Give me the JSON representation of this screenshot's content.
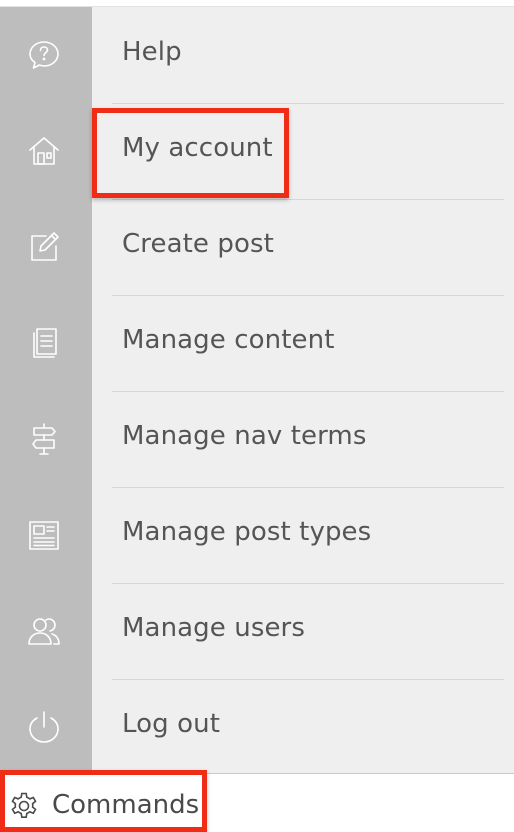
{
  "menu": {
    "items": [
      {
        "label": "Help",
        "icon": "help-bubble-icon"
      },
      {
        "label": "My account",
        "icon": "home-icon"
      },
      {
        "label": "Create post",
        "icon": "edit-icon"
      },
      {
        "label": "Manage content",
        "icon": "documents-icon"
      },
      {
        "label": "Manage nav terms",
        "icon": "signpost-icon"
      },
      {
        "label": "Manage post types",
        "icon": "newspaper-icon"
      },
      {
        "label": "Manage users",
        "icon": "users-icon"
      },
      {
        "label": "Log out",
        "icon": "power-icon"
      }
    ]
  },
  "commands": {
    "label": "Commands",
    "icon": "gear-icon"
  },
  "colors": {
    "rail": "#bdbdbd",
    "panel": "#efefef",
    "text": "#555555",
    "highlight": "#f02b16"
  }
}
